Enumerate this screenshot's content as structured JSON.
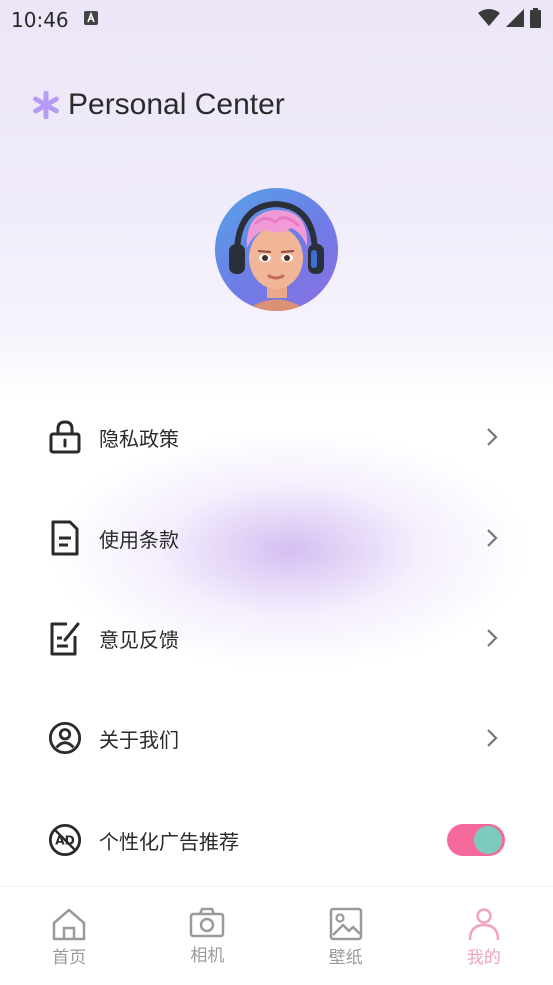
{
  "status_bar": {
    "time": "10:46"
  },
  "header": {
    "title": "Personal Center"
  },
  "menu": {
    "items": [
      {
        "label": "隐私政策",
        "icon": "lock-icon"
      },
      {
        "label": "使用条款",
        "icon": "document-icon"
      },
      {
        "label": "意见反馈",
        "icon": "feedback-icon"
      },
      {
        "label": "关于我们",
        "icon": "user-circle-icon"
      }
    ],
    "ad_toggle": {
      "label": "个性化广告推荐",
      "icon": "ad-icon",
      "on": true
    }
  },
  "tab_bar": {
    "tabs": [
      {
        "label": "首页",
        "icon": "home-icon",
        "active": false
      },
      {
        "label": "相机",
        "icon": "camera-icon",
        "active": false
      },
      {
        "label": "壁纸",
        "icon": "image-icon",
        "active": false
      },
      {
        "label": "我的",
        "icon": "person-icon",
        "active": true
      }
    ]
  },
  "colors": {
    "accent_pink": "#f3a3be",
    "toggle_track": "#f56a9d",
    "toggle_knob": "#7ecabd",
    "asterisk": "#b69cf2"
  }
}
